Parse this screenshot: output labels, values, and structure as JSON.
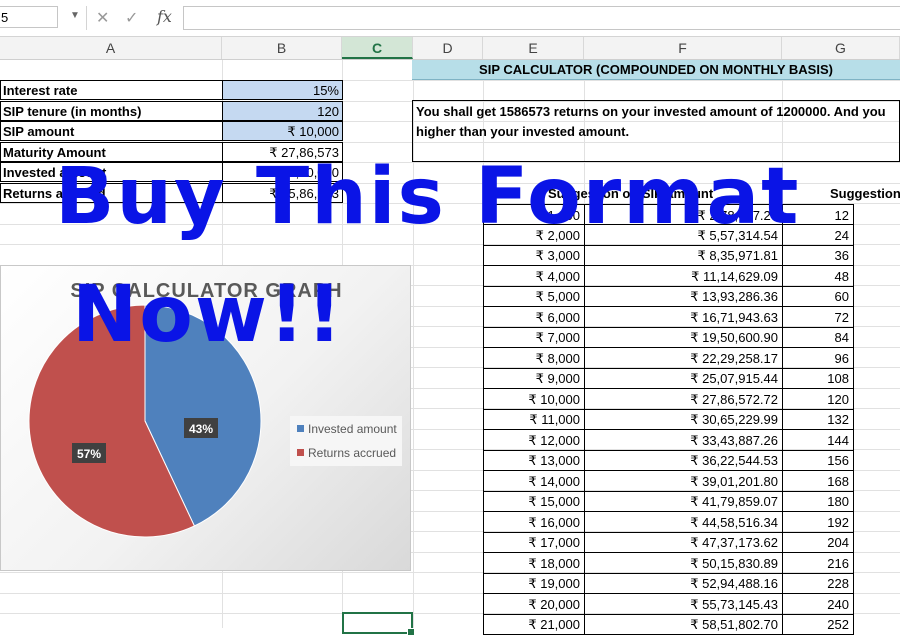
{
  "formula_bar": {
    "name_box": "5",
    "cancel_icon": "cancel-icon",
    "enter_icon": "checkmark-icon",
    "fx_label": "fx",
    "formula": ""
  },
  "columns": [
    "A",
    "B",
    "C",
    "D",
    "E",
    "F",
    "G"
  ],
  "selected_column": "C",
  "inputs": {
    "rows": [
      {
        "label": "Interest rate",
        "value": "15%"
      },
      {
        "label": "SIP tenure (in months)",
        "value": "120"
      },
      {
        "label": "SIP amount",
        "value": "₹ 10,000"
      },
      {
        "label": "Maturity Amount",
        "value": "₹ 27,86,573"
      },
      {
        "label": "Invested amount",
        "value": "₹ 12,00,000"
      },
      {
        "label": "Returns accrued",
        "value": "₹ 15,86,573"
      }
    ]
  },
  "calculator_title": "SIP CALCULATOR (COMPOUNDED ON MONTHLY BASIS)",
  "message": {
    "line1": "You shall get 1586573 returns on your invested amount of 1200000. And you",
    "line2": "higher than your invested amount."
  },
  "suggestion_table": {
    "headers": [
      "Suggestion on SIP amount",
      "Suggestion"
    ],
    "rows": [
      [
        "₹ 1,000",
        "₹ 2,78,657.27",
        "12"
      ],
      [
        "₹ 2,000",
        "₹ 5,57,314.54",
        "24"
      ],
      [
        "₹ 3,000",
        "₹ 8,35,971.81",
        "36"
      ],
      [
        "₹ 4,000",
        "₹ 11,14,629.09",
        "48"
      ],
      [
        "₹ 5,000",
        "₹ 13,93,286.36",
        "60"
      ],
      [
        "₹ 6,000",
        "₹ 16,71,943.63",
        "72"
      ],
      [
        "₹ 7,000",
        "₹ 19,50,600.90",
        "84"
      ],
      [
        "₹ 8,000",
        "₹ 22,29,258.17",
        "96"
      ],
      [
        "₹ 9,000",
        "₹ 25,07,915.44",
        "108"
      ],
      [
        "₹ 10,000",
        "₹ 27,86,572.72",
        "120"
      ],
      [
        "₹ 11,000",
        "₹ 30,65,229.99",
        "132"
      ],
      [
        "₹ 12,000",
        "₹ 33,43,887.26",
        "144"
      ],
      [
        "₹ 13,000",
        "₹ 36,22,544.53",
        "156"
      ],
      [
        "₹ 14,000",
        "₹ 39,01,201.80",
        "168"
      ],
      [
        "₹ 15,000",
        "₹ 41,79,859.07",
        "180"
      ],
      [
        "₹ 16,000",
        "₹ 44,58,516.34",
        "192"
      ],
      [
        "₹ 17,000",
        "₹ 47,37,173.62",
        "204"
      ],
      [
        "₹ 18,000",
        "₹ 50,15,830.89",
        "216"
      ],
      [
        "₹ 19,000",
        "₹ 52,94,488.16",
        "228"
      ],
      [
        "₹ 20,000",
        "₹ 55,73,145.43",
        "240"
      ],
      [
        "₹ 21,000",
        "₹ 58,51,802.70",
        "252"
      ]
    ]
  },
  "chart_data": {
    "type": "pie",
    "title": "SIP CALCULATOR GRAPH",
    "categories": [
      "Invested amount",
      "Returns accrued"
    ],
    "values": [
      43,
      57
    ],
    "labels": [
      "43%",
      "57%"
    ],
    "colors": [
      "#4f81bd",
      "#c0504d"
    ],
    "legend_position": "right"
  },
  "watermark": {
    "line1": "Buy This Format",
    "line2": "Now!!"
  },
  "colors": {
    "title_fill": "#b7dee8",
    "input_fill": "#c5d9f1",
    "selection": "#217346",
    "watermark": "#0a14e6"
  }
}
